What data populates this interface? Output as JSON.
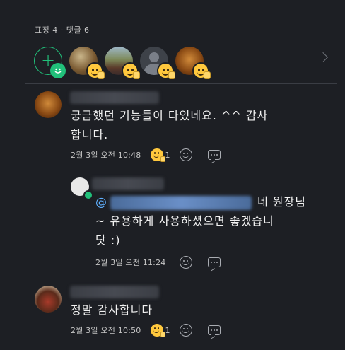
{
  "stats": {
    "text": "표정 4 · 댓글 6"
  },
  "reactions": {
    "avatars": [
      {
        "name": "reactor-1",
        "colors": [
          "#8b6b3a",
          "#4a3a2a"
        ]
      },
      {
        "name": "reactor-2",
        "colors": [
          "#5c7d9e",
          "#2e3a4a"
        ]
      },
      {
        "name": "reactor-3",
        "colors": [
          "#6e737b",
          "#3e4249"
        ]
      },
      {
        "name": "reactor-4",
        "colors": [
          "#9a5a1e",
          "#4a2a10"
        ]
      }
    ]
  },
  "comments": [
    {
      "text_line1": "궁금했던 기능들이 다있네요. ^^ 감사",
      "text_line2": "합니다.",
      "date": "2월 3일 오전 10:48",
      "reaction_count": "1"
    },
    {
      "mention": "@",
      "text_line1_end": "네 원장님",
      "text_line2": "~ 유용하게 사용하셨으면 좋겠습니",
      "text_line3": "닷 :)",
      "date": "2월 3일 오전 11:24"
    },
    {
      "text_line1": "정말 감사합니다",
      "date": "2월 3일 오전 10:50",
      "reaction_count": "1"
    }
  ],
  "colors": {
    "accent": "#21c07a",
    "background": "#1d1f24",
    "mention": "#5fb0ff"
  }
}
